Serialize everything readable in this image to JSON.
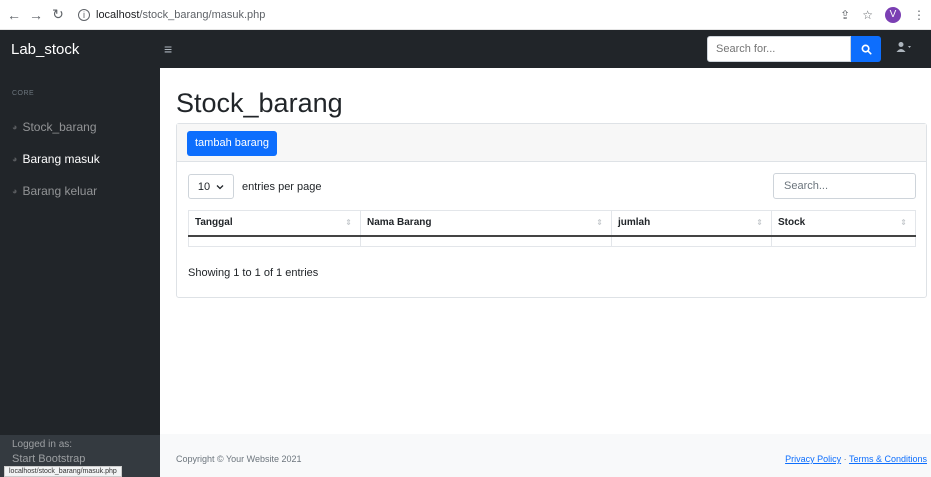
{
  "browser": {
    "url_host": "localhost",
    "url_path": "/stock_barang/masuk.php",
    "profile_initial": "V",
    "status_url": "localhost/stock_barang/masuk.php"
  },
  "navbar": {
    "brand": "Lab_stock",
    "search_placeholder": "Search for..."
  },
  "sidebar": {
    "heading": "CORE",
    "items": [
      {
        "label": "Stock_barang",
        "active": false
      },
      {
        "label": "Barang masuk",
        "active": true
      },
      {
        "label": "Barang keluar",
        "active": false
      }
    ],
    "footer_label": "Logged in as:",
    "footer_user": "Start Bootstrap"
  },
  "main": {
    "title": "Stock_barang",
    "add_button": "tambah barang",
    "entries_value": "10",
    "entries_label": "entries per page",
    "table_search_placeholder": "Search...",
    "columns": [
      "Tanggal",
      "Nama Barang",
      "jumlah",
      "Stock"
    ],
    "rows": [
      [
        "",
        "",
        "",
        ""
      ]
    ],
    "info": "Showing 1 to 1 of 1 entries"
  },
  "footer": {
    "copyright": "Copyright © Your Website 2021",
    "privacy": "Privacy Policy",
    "separator": "·",
    "terms": "Terms & Conditions"
  },
  "colors": {
    "dark": "#212529",
    "primary": "#0d6efd"
  }
}
